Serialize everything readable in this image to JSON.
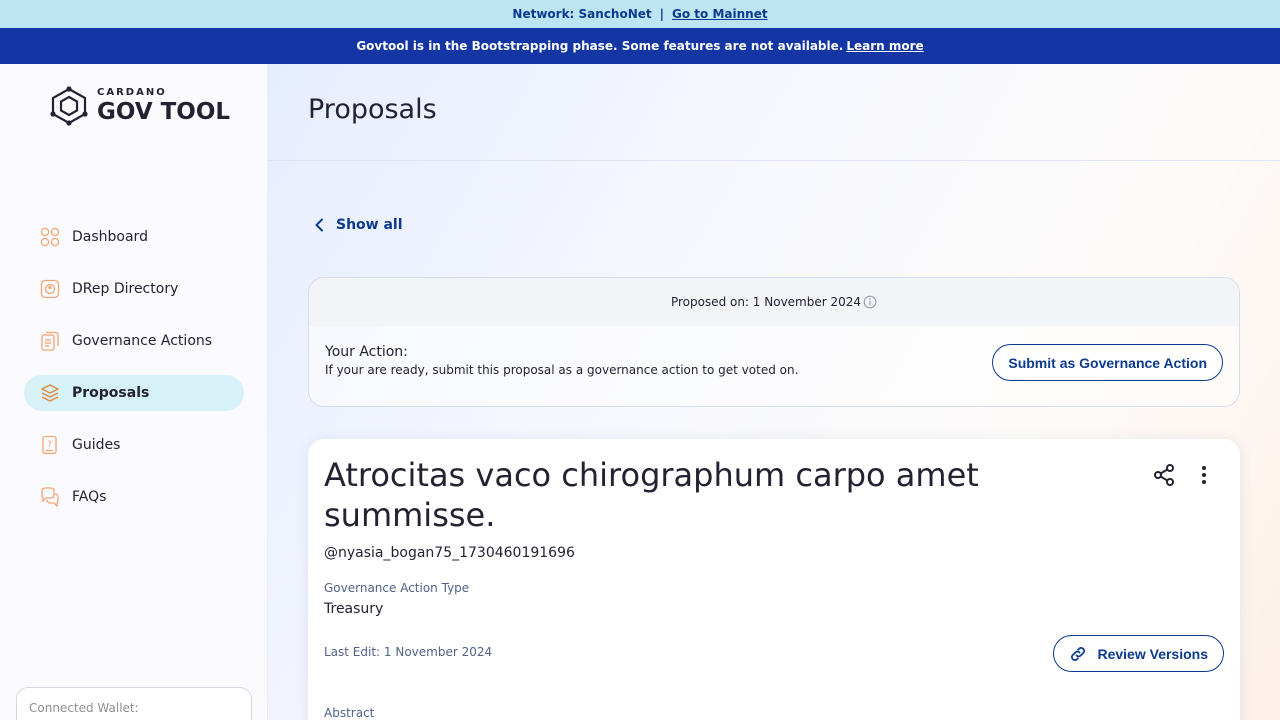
{
  "top_banner": {
    "network": "Network: SanchoNet",
    "separator": "|",
    "link": "Go to Mainnet"
  },
  "phase_banner": {
    "text": "Govtool is in the Bootstrapping phase. Some features are not available.",
    "link": "Learn more"
  },
  "sidebar": {
    "logo_small": "CARDANO",
    "logo_big": "GOV TOOL",
    "items": [
      {
        "label": "Dashboard",
        "icon": "dashboard-icon"
      },
      {
        "label": "DRep Directory",
        "icon": "drep-directory-icon"
      },
      {
        "label": "Governance Actions",
        "icon": "governance-actions-icon"
      },
      {
        "label": "Proposals",
        "icon": "proposals-icon",
        "active": true
      },
      {
        "label": "Guides",
        "icon": "guides-icon"
      },
      {
        "label": "FAQs",
        "icon": "faqs-icon"
      }
    ],
    "wallet_label": "Connected Wallet:"
  },
  "main": {
    "page_title": "Proposals",
    "show_all": "Show all",
    "action_card": {
      "proposed_on": "Proposed on: 1 November 2024",
      "your_action_label": "Your Action:",
      "your_action_desc": "If your are ready, submit this proposal as a governance action to get voted on.",
      "submit_button": "Submit as Governance Action"
    },
    "proposal": {
      "title": "Atrocitas vaco chirographum carpo amet summisse.",
      "username": "@nyasia_bogan75_1730460191696",
      "type_label": "Governance Action Type",
      "type_value": "Treasury",
      "last_edit": "Last Edit: 1 November 2024",
      "review_button": "Review Versions",
      "abstract_label": "Abstract"
    }
  },
  "colors": {
    "primary_blue": "#0c3a8f",
    "banner_light": "#bde5f1",
    "banner_dark": "#1436a4",
    "active_nav": "#d6f2f8",
    "icon_orange": "#f0a572"
  }
}
